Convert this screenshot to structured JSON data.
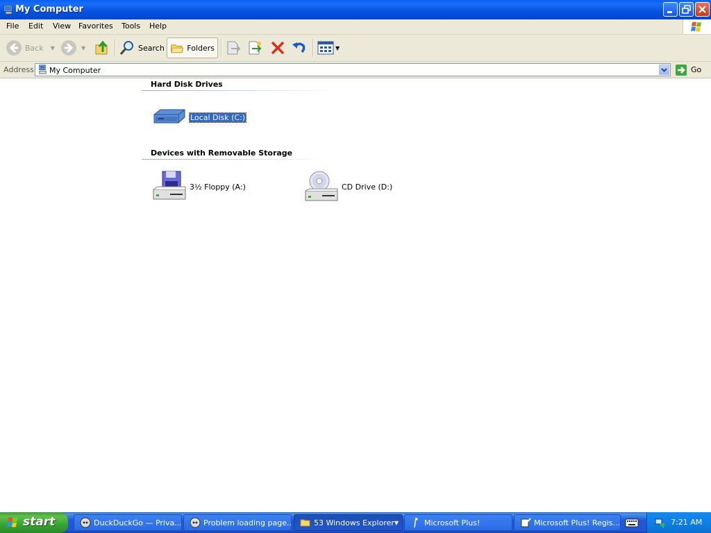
{
  "window": {
    "title": "My Computer"
  },
  "menu": [
    "File",
    "Edit",
    "View",
    "Favorites",
    "Tools",
    "Help"
  ],
  "toolbar": {
    "back": "Back",
    "search": "Search",
    "folders": "Folders"
  },
  "address": {
    "label": "Address",
    "value": "My Computer",
    "go": "Go"
  },
  "groups": {
    "hard_disk": {
      "title": "Hard Disk Drives",
      "items": [
        "Local Disk (C:)"
      ]
    },
    "removable": {
      "title": "Devices with Removable Storage",
      "items": [
        "3½ Floppy (A:)",
        "CD Drive (D:)"
      ]
    }
  },
  "taskbar": {
    "start": "start",
    "tasks": [
      "DuckDuckGo — Priva...",
      "Problem loading page...",
      "53 Windows Explorer",
      "Microsoft Plus!",
      "Microsoft Plus! Regis..."
    ],
    "clock": "7:21 AM"
  }
}
